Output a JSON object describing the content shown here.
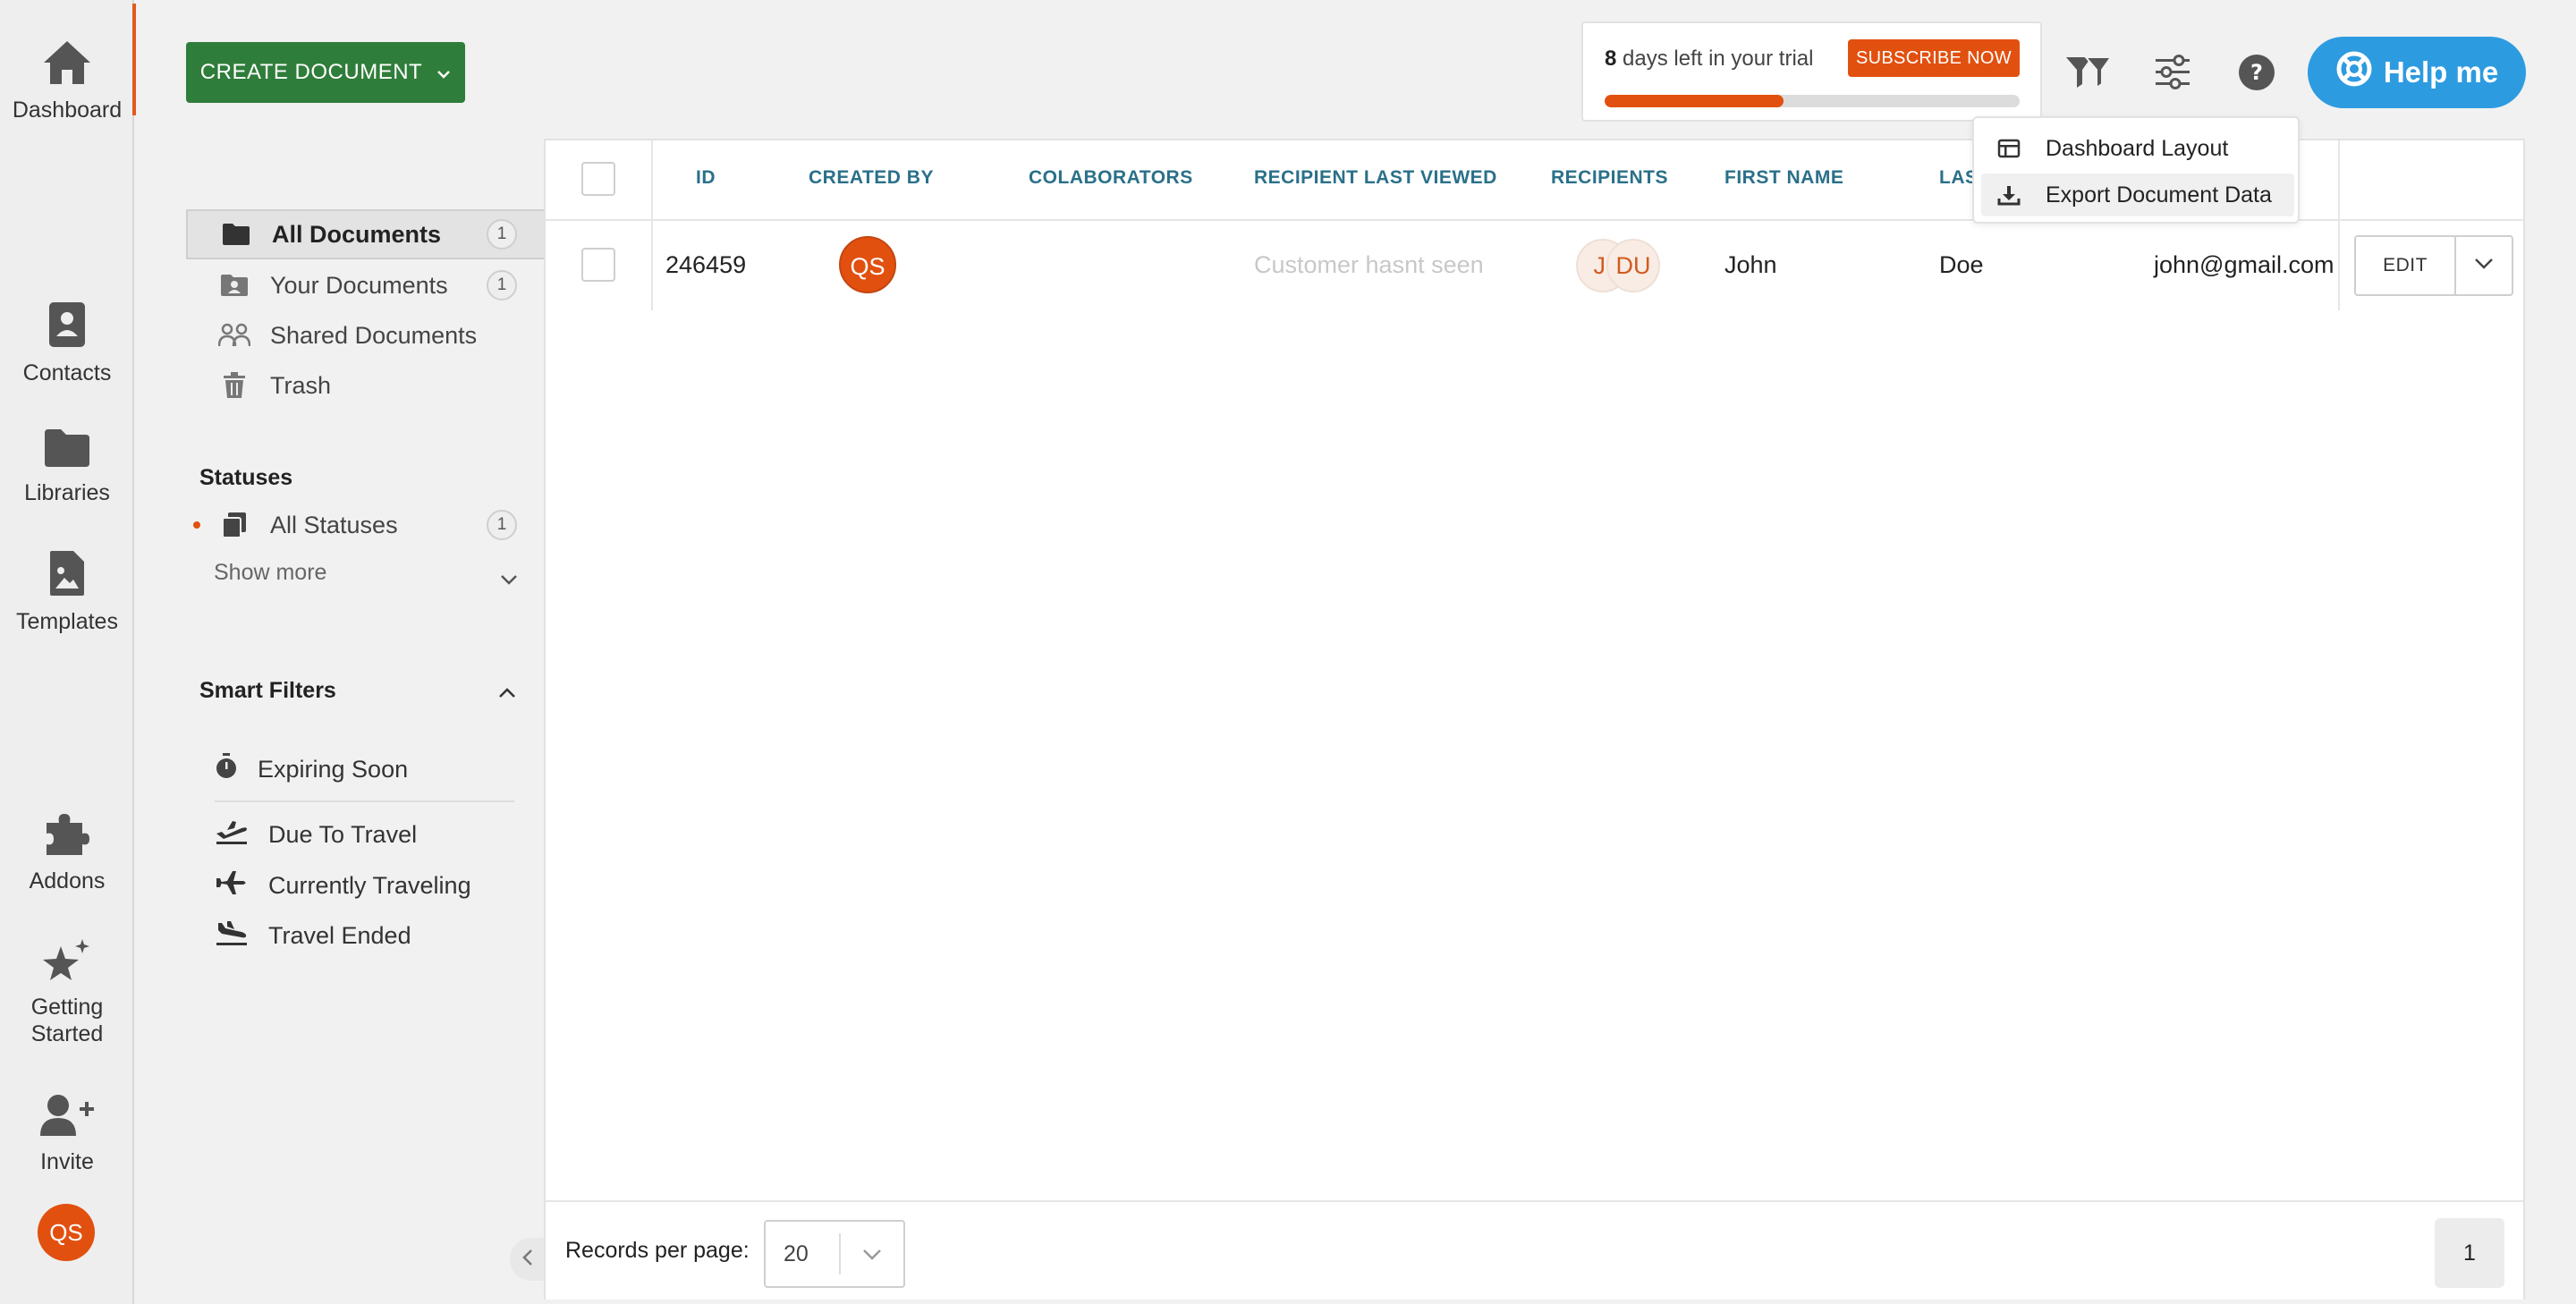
{
  "rail": {
    "items": [
      {
        "label": "Dashboard",
        "icon": "home-icon"
      },
      {
        "label": "Contacts",
        "icon": "contact-card-icon"
      },
      {
        "label": "Libraries",
        "icon": "folder-icon"
      },
      {
        "label": "Templates",
        "icon": "image-file-icon"
      },
      {
        "label": "Addons",
        "icon": "puzzle-icon"
      },
      {
        "label": "Getting Started",
        "icon": "sparkle-stars-icon"
      },
      {
        "label": "Invite",
        "icon": "user-plus-icon"
      }
    ],
    "avatar_initials": "QS"
  },
  "create_button": {
    "label": "CREATE DOCUMENT"
  },
  "sidebar": {
    "documents": [
      {
        "label": "All Documents",
        "count": "1",
        "icon": "folder-icon",
        "active": true
      },
      {
        "label": "Your Documents",
        "count": "1",
        "icon": "user-folder-icon"
      },
      {
        "label": "Shared Documents",
        "icon": "users-icon"
      },
      {
        "label": "Trash",
        "icon": "trash-icon"
      }
    ],
    "statuses_title": "Statuses",
    "statuses": [
      {
        "label": "All Statuses",
        "count": "1",
        "icon": "documents-stack-icon"
      }
    ],
    "show_more": "Show more",
    "smart_filters_title": "Smart Filters",
    "smart_filters": [
      {
        "label": "Expiring Soon",
        "icon": "stopwatch-icon"
      },
      {
        "label": "Due To Travel",
        "icon": "plane-departure-icon"
      },
      {
        "label": "Currently Traveling",
        "icon": "plane-icon"
      },
      {
        "label": "Travel Ended",
        "icon": "plane-arrival-icon"
      }
    ]
  },
  "trial": {
    "days": "8",
    "text": "days left in your trial",
    "subscribe_label": "SUBSCRIBE NOW",
    "progress_fraction": 0.43
  },
  "help_button": {
    "label": "Help me"
  },
  "dropdown": {
    "items": [
      {
        "label": "Dashboard Layout",
        "icon": "layout-icon"
      },
      {
        "label": "Export Document Data",
        "icon": "download-icon"
      }
    ]
  },
  "table": {
    "columns": [
      "ID",
      "CREATED BY",
      "COLABORATORS",
      "RECIPIENT LAST VIEWED",
      "RECIPIENTS",
      "FIRST NAME",
      "LAS"
    ],
    "rows": [
      {
        "id": "246459",
        "created_by": "QS",
        "recipient_last_viewed": "Customer hasnt seen",
        "recipients": [
          "JI",
          "DU"
        ],
        "first_name": "John",
        "last_name": "Doe",
        "email": "john@gmail.com",
        "edit_label": "EDIT"
      }
    ]
  },
  "footer": {
    "records_label": "Records per page:",
    "records_value": "20",
    "page": "1"
  },
  "colors": {
    "accent_orange": "#e2500f",
    "create_green": "#2f7d3a",
    "help_blue": "#2d9be0",
    "header_teal": "#2a7089"
  }
}
